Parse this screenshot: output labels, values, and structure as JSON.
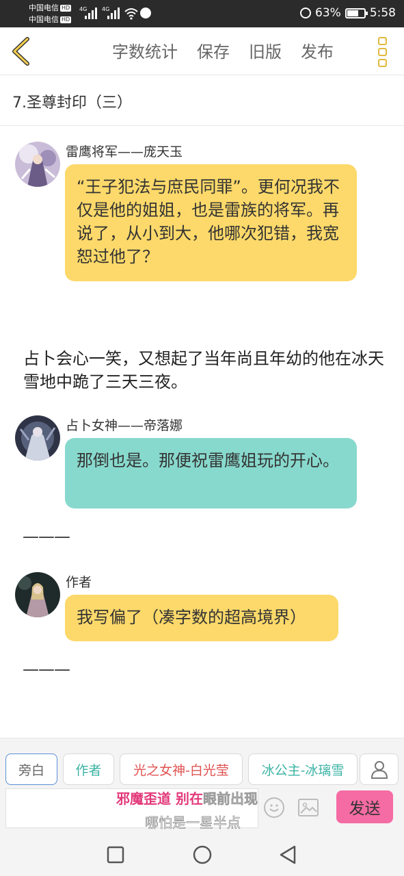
{
  "status_bar": {
    "carrier_1": "中国电信",
    "carrier_2": "中国电信",
    "hd_badge": "HD",
    "network_1": "4G",
    "network_2": "4G",
    "battery": "63%",
    "time": "5:58"
  },
  "toolbar": {
    "actions": [
      "字数统计",
      "保存",
      "旧版",
      "发布"
    ]
  },
  "chapter": {
    "title": "7.圣尊封印（三）"
  },
  "messages": [
    {
      "speaker": "雷鹰将军——庞天玉",
      "text": "“王子犯法与庶民同罪”。更何况我不仅是他的姐姐，也是雷族的将军。再说了，从小到大，他哪次犯错，我宽恕过他了？",
      "color": "#fcd96a"
    },
    {
      "narration": "占卜会心一笑，又想起了当年尚且年幼的他在冰天雪地中跪了三天三夜。"
    },
    {
      "speaker": "占卜女神——帝落娜",
      "text": "那倒也是。那便祝雷鹰姐玩的开心。",
      "color": "#88d9cd"
    },
    {
      "separator": "———"
    },
    {
      "speaker": "作者",
      "text": "我写偏了（凑字数的超高境界）",
      "color": "#fcd96a"
    },
    {
      "separator": "———"
    }
  ],
  "roles": [
    {
      "label": "旁白",
      "color": "#666666"
    },
    {
      "label": "作者",
      "color": "#3bb3a4"
    },
    {
      "label": "光之女神-白光莹",
      "color": "#e05252"
    },
    {
      "label": "冰公主-冰璃雪",
      "color": "#3bb3a4"
    }
  ],
  "composer": {
    "overlay_highlight": "邪魔歪道 别在",
    "overlay_rest": "眼前出现",
    "overlay_line2": "哪怕是一星半点",
    "send_label": "发送"
  },
  "icons": {
    "back": "back-chevron-icon",
    "menu": "more-menu-icon",
    "add_role": "person-icon",
    "emoji": "emoji-icon",
    "image": "image-icon",
    "nav_recent": "square-icon",
    "nav_home": "circle-icon",
    "nav_back": "triangle-back-icon"
  },
  "colors": {
    "accent_yellow": "#e0b93d",
    "bubble_yellow": "#fcd96a",
    "bubble_teal": "#88d9cd",
    "send_pink": "#f56ba3"
  }
}
